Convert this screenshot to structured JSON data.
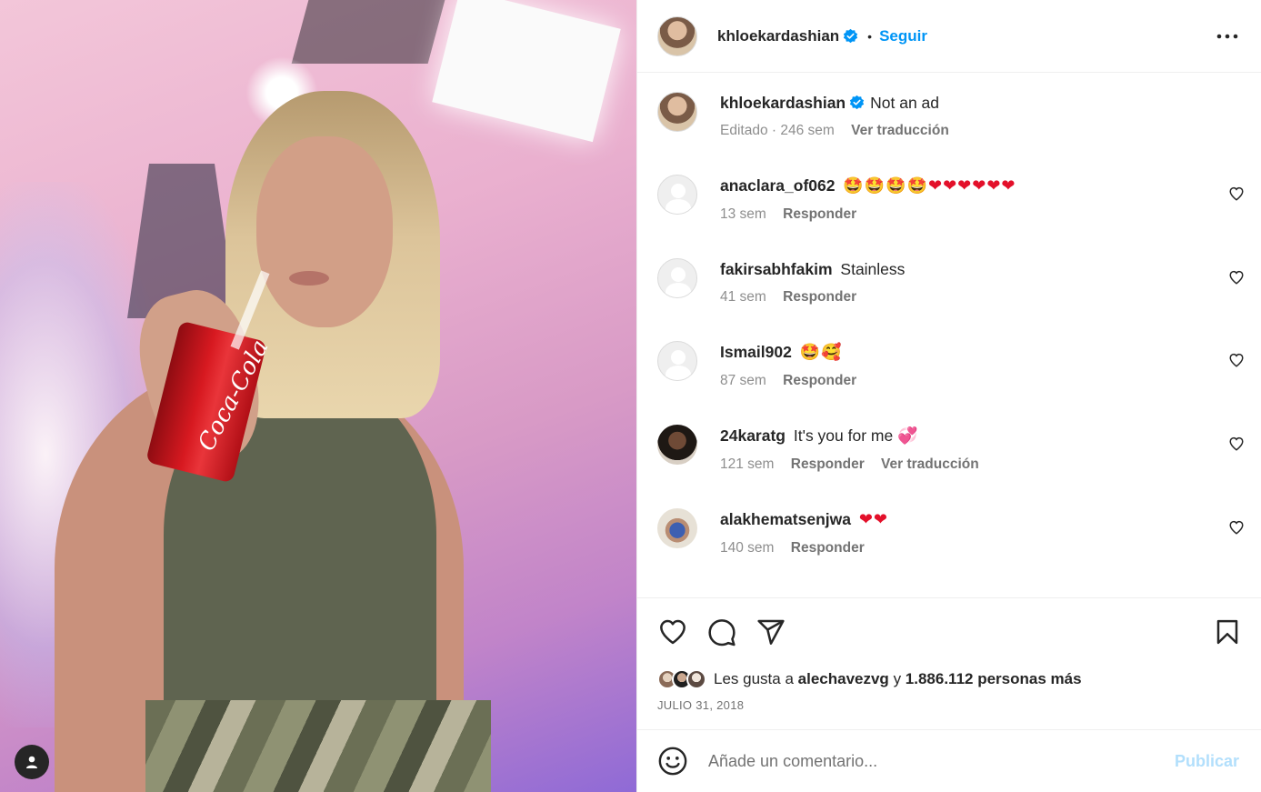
{
  "header": {
    "username": "khloekardashian",
    "separator": "•",
    "follow_label": "Seguir",
    "more_icon": "more-horizontal-icon"
  },
  "caption": {
    "username": "khloekardashian",
    "text": "Not an ad",
    "edited": "Editado · 246 sem",
    "translate": "Ver traducción"
  },
  "comments": [
    {
      "username": "anaclara_of062",
      "text": "",
      "emoji": "🤩🤩🤩🤩",
      "hearts": "❤❤❤❤❤❤",
      "time": "13 sem",
      "reply": "Responder",
      "translate": ""
    },
    {
      "username": "fakirsabhfakim",
      "text": "Stainless",
      "emoji": "",
      "hearts": "",
      "time": "41 sem",
      "reply": "Responder",
      "translate": ""
    },
    {
      "username": "Ismail902",
      "text": "",
      "emoji": "🤩🥰",
      "hearts": "",
      "time": "87 sem",
      "reply": "Responder",
      "translate": ""
    },
    {
      "username": "24karatg",
      "text": "It's you for me",
      "emoji": "",
      "hearts": "💞",
      "time": "121 sem",
      "reply": "Responder",
      "translate": "Ver traducción"
    },
    {
      "username": "alakhematsenjwa",
      "text": "",
      "emoji": "",
      "hearts": "❤❤",
      "time": "140 sem",
      "reply": "Responder",
      "translate": ""
    }
  ],
  "likes": {
    "prefix": "Les gusta a",
    "user": "alechavezvg",
    "middle": "y",
    "count": "1.886.112 personas más"
  },
  "date": "JULIO 31, 2018",
  "composer": {
    "placeholder": "Añade un comentario...",
    "publish_label": "Publicar"
  },
  "photo": {
    "can_text": "Coca-Cola"
  },
  "colors": {
    "accent": "#0095f6",
    "publish_disabled": "#b2dffc",
    "heart_red": "#e3102a",
    "verified": "#0095f6"
  }
}
